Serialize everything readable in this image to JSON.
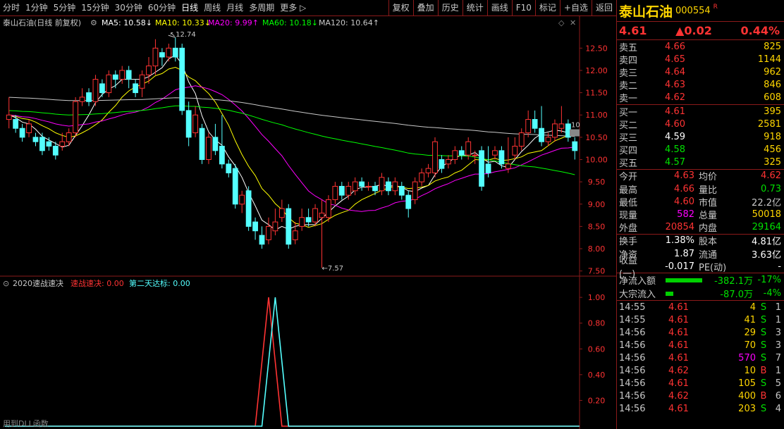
{
  "toolbar": {
    "left": [
      "分时",
      "1分钟",
      "5分钟",
      "15分钟",
      "30分钟",
      "60分钟",
      "日线",
      "周线",
      "月线",
      "多周期",
      "更多 ▷"
    ],
    "active": "日线",
    "right": [
      "复权",
      "叠加",
      "历史",
      "统计",
      "画线",
      "F10",
      "标记",
      "+自选",
      "返回"
    ]
  },
  "main": {
    "title": "泰山石油(日线 前复权)",
    "ma": [
      {
        "label": "MA5: 10.58↓",
        "color": "#ffffff"
      },
      {
        "label": "MA10: 10.33↓",
        "color": "#ffff00"
      },
      {
        "label": "MA20: 9.99↑",
        "color": "#ff00ff"
      },
      {
        "label": "MA60: 10.18↓",
        "color": "#00ff00"
      },
      {
        "label": "MA120: 10.64↑",
        "color": "#c8c8c8"
      }
    ],
    "hi_label": "12.74",
    "lo_label": "7.57",
    "last_marker": "10"
  },
  "indicator": {
    "name": "2020速战速决",
    "s1": "速战速决: 0.00",
    "s2": "第二天达标: 0.00",
    "footer": "用到DLL函数"
  },
  "colors": {
    "up": "#ff3333",
    "down": "#54ffff",
    "border": "#8b1a1a"
  },
  "chart_data": [
    {
      "type": "candlestick",
      "y_ticks": [
        "12.50",
        "12.00",
        "11.50",
        "11.00",
        "10.50",
        "10.00",
        "9.50",
        "9.00",
        "8.50",
        "8.00",
        "7.50"
      ],
      "ylim": [
        7.4,
        12.9
      ],
      "candles": [
        [
          10.9,
          11.0,
          10.7,
          11.4
        ],
        [
          10.9,
          10.7,
          10.6,
          11.0
        ],
        [
          10.7,
          10.5,
          10.4,
          10.8
        ],
        [
          10.6,
          10.8,
          10.5,
          10.9
        ],
        [
          10.5,
          10.4,
          10.3,
          10.6
        ],
        [
          10.5,
          10.2,
          10.1,
          10.6
        ],
        [
          10.4,
          10.3,
          10.2,
          10.5
        ],
        [
          10.3,
          10.1,
          10.0,
          10.4
        ],
        [
          10.3,
          10.4,
          10.2,
          10.6
        ],
        [
          10.4,
          10.6,
          10.3,
          10.7
        ],
        [
          10.6,
          11.3,
          10.5,
          11.4
        ],
        [
          11.3,
          11.4,
          11.2,
          11.6
        ],
        [
          11.5,
          11.3,
          11.2,
          11.6
        ],
        [
          11.3,
          11.8,
          11.2,
          11.9
        ],
        [
          11.7,
          11.5,
          11.4,
          11.8
        ],
        [
          11.5,
          11.9,
          11.4,
          12.0
        ],
        [
          11.9,
          11.8,
          11.6,
          12.0
        ],
        [
          11.8,
          12.0,
          11.7,
          12.1
        ],
        [
          12.0,
          11.8,
          11.6,
          12.1
        ],
        [
          11.7,
          11.5,
          11.4,
          11.8
        ],
        [
          11.6,
          11.9,
          11.4,
          12.0
        ],
        [
          11.9,
          12.1,
          11.7,
          12.3
        ],
        [
          12.1,
          12.5,
          11.9,
          12.7
        ],
        [
          12.4,
          12.3,
          12.1,
          12.5
        ],
        [
          12.3,
          12.5,
          12.2,
          12.6
        ],
        [
          12.5,
          12.3,
          12.2,
          12.74
        ],
        [
          12.5,
          11.1,
          11.0,
          12.6
        ],
        [
          11.1,
          10.5,
          10.3,
          11.3
        ],
        [
          10.6,
          11.0,
          10.5,
          11.2
        ],
        [
          10.7,
          10.0,
          9.9,
          10.8
        ],
        [
          10.0,
          10.5,
          9.9,
          10.6
        ],
        [
          10.5,
          10.2,
          10.1,
          10.8
        ],
        [
          10.3,
          9.9,
          9.8,
          11.0
        ],
        [
          9.9,
          9.7,
          9.6,
          10.0
        ],
        [
          9.8,
          9.0,
          8.9,
          9.9
        ],
        [
          9.0,
          9.2,
          8.8,
          9.3
        ],
        [
          9.3,
          8.5,
          8.4,
          9.4
        ],
        [
          8.6,
          8.4,
          8.2,
          8.7
        ],
        [
          8.3,
          8.1,
          8.0,
          8.5
        ],
        [
          8.2,
          8.5,
          8.1,
          8.7
        ],
        [
          8.4,
          8.6,
          8.3,
          8.9
        ],
        [
          8.7,
          8.9,
          8.6,
          9.1
        ],
        [
          8.9,
          8.1,
          8.0,
          9.0
        ],
        [
          8.2,
          8.4,
          8.1,
          8.6
        ],
        [
          8.5,
          8.7,
          8.4,
          8.9
        ],
        [
          8.7,
          8.6,
          8.5,
          8.9
        ],
        [
          8.6,
          8.9,
          8.5,
          9.0
        ],
        [
          8.7,
          8.8,
          7.57,
          9.1
        ],
        [
          8.7,
          9.1,
          8.6,
          9.2
        ],
        [
          9.1,
          9.4,
          9.0,
          9.5
        ],
        [
          9.4,
          9.2,
          9.1,
          9.5
        ],
        [
          9.2,
          9.4,
          9.1,
          9.5
        ],
        [
          9.3,
          9.5,
          9.2,
          9.6
        ],
        [
          9.5,
          9.4,
          9.3,
          9.6
        ],
        [
          9.4,
          9.4,
          9.3,
          9.5
        ],
        [
          9.4,
          9.3,
          9.2,
          9.5
        ],
        [
          9.3,
          9.6,
          9.2,
          9.7
        ],
        [
          9.5,
          9.3,
          9.2,
          9.6
        ],
        [
          9.3,
          9.5,
          9.2,
          9.6
        ],
        [
          9.4,
          9.2,
          9.1,
          9.5
        ],
        [
          9.2,
          8.9,
          8.7,
          9.3
        ],
        [
          9.1,
          9.5,
          9.0,
          9.6
        ],
        [
          9.5,
          9.7,
          9.4,
          9.8
        ],
        [
          9.7,
          9.8,
          9.6,
          9.9
        ],
        [
          9.7,
          10.4,
          9.6,
          10.5
        ],
        [
          10.0,
          9.8,
          9.7,
          10.1
        ],
        [
          9.9,
          10.0,
          9.8,
          10.1
        ],
        [
          10.0,
          10.2,
          9.9,
          10.3
        ],
        [
          10.2,
          10.1,
          10.0,
          10.3
        ],
        [
          10.1,
          10.4,
          10.0,
          10.5
        ],
        [
          10.1,
          10.1,
          9.9,
          10.2
        ],
        [
          10.2,
          9.4,
          9.3,
          10.3
        ],
        [
          9.9,
          9.7,
          9.6,
          10.3
        ],
        [
          10.1,
          10.2,
          10.0,
          10.3
        ],
        [
          10.2,
          9.9,
          9.8,
          10.3
        ],
        [
          9.8,
          9.9,
          9.7,
          10.5
        ],
        [
          10.1,
          10.3,
          10.0,
          10.5
        ],
        [
          10.3,
          10.6,
          10.2,
          10.7
        ],
        [
          10.6,
          10.9,
          10.5,
          11.1
        ],
        [
          10.9,
          10.7,
          10.6,
          11.1
        ],
        [
          10.7,
          10.4,
          10.3,
          11.2
        ],
        [
          10.4,
          10.5,
          10.3,
          10.6
        ],
        [
          10.5,
          10.8,
          10.4,
          10.9
        ],
        [
          10.7,
          10.8,
          10.6,
          11.2
        ],
        [
          10.8,
          10.5,
          10.4,
          10.9
        ],
        [
          10.4,
          10.2,
          10.0,
          10.5
        ]
      ],
      "ma_series": [
        "MA5",
        "MA10",
        "MA20",
        "MA60",
        "MA120"
      ]
    },
    {
      "type": "line",
      "y_ticks": [
        "1.00",
        "0.80",
        "0.60",
        "0.40",
        "0.20"
      ],
      "ylim": [
        0,
        1.05
      ],
      "series": [
        {
          "name": "速战速决",
          "color": "#ff3333",
          "spikes": [
            {
              "from": 37,
              "peak": 39,
              "to": 41,
              "value": 1.0
            }
          ]
        },
        {
          "name": "第二天达标",
          "color": "#54ffff",
          "spikes": [
            {
              "from": 38,
              "peak": 40,
              "to": 42,
              "value": 1.0
            }
          ]
        }
      ]
    }
  ],
  "side": {
    "name": "泰山石油",
    "code": "000554",
    "flag": "R",
    "price": "4.61",
    "change": "▲0.02",
    "pct": "0.44%",
    "asks": [
      {
        "lbl": "卖五",
        "p": "4.66",
        "v": "825"
      },
      {
        "lbl": "卖四",
        "p": "4.65",
        "v": "1144"
      },
      {
        "lbl": "卖三",
        "p": "4.64",
        "v": "962"
      },
      {
        "lbl": "卖二",
        "p": "4.63",
        "v": "846"
      },
      {
        "lbl": "卖一",
        "p": "4.62",
        "v": "608"
      }
    ],
    "bids": [
      {
        "lbl": "买一",
        "p": "4.61",
        "v": "395",
        "pc": "#ff3333"
      },
      {
        "lbl": "买二",
        "p": "4.60",
        "v": "2581",
        "pc": "#ff3333"
      },
      {
        "lbl": "买三",
        "p": "4.59",
        "v": "918",
        "pc": "#ffffff"
      },
      {
        "lbl": "买四",
        "p": "4.58",
        "v": "456",
        "pc": "#00e000"
      },
      {
        "lbl": "买五",
        "p": "4.57",
        "v": "325",
        "pc": "#00e000"
      }
    ],
    "stats": [
      {
        "a": "今开",
        "b": "4.63",
        "bc": "#ff3333",
        "c": "均价",
        "d": "4.62",
        "dc": "#ff3333"
      },
      {
        "a": "最高",
        "b": "4.66",
        "bc": "#ff3333",
        "c": "量比",
        "d": "0.73",
        "dc": "#00e000"
      },
      {
        "a": "最低",
        "b": "4.60",
        "bc": "#ff3333",
        "c": "市值",
        "d": "22.2亿",
        "dc": "#c8c8c8"
      },
      {
        "a": "现量",
        "b": "582",
        "bc": "#ff00ff",
        "c": "总量",
        "d": "50018",
        "dc": "#ffd600"
      },
      {
        "a": "外盘",
        "b": "20854",
        "bc": "#ff3333",
        "c": "内盘",
        "d": "29164",
        "dc": "#00e000"
      }
    ],
    "stats2": [
      {
        "a": "换手",
        "b": "1.38%",
        "c": "股本",
        "d": "4.81亿"
      },
      {
        "a": "净资",
        "b": "1.87",
        "c": "流通",
        "d": "3.63亿"
      },
      {
        "a": "收益(一)",
        "b": "-0.017",
        "c": "PE(动)",
        "d": "-"
      }
    ],
    "flows": [
      {
        "lbl": "净流入额",
        "bar": 0.95,
        "v": "-382.1万",
        "p": "-17%"
      },
      {
        "lbl": "大宗流入",
        "bar": 0.2,
        "v": "-87.0万",
        "p": "-4%"
      }
    ],
    "ticks": [
      {
        "t": "14:55",
        "p": "4.61",
        "v": "4",
        "d": "S",
        "dc": "#00e000",
        "vc": "#ffd600",
        "n": "1"
      },
      {
        "t": "14:55",
        "p": "4.61",
        "v": "41",
        "d": "S",
        "dc": "#00e000",
        "vc": "#ffd600",
        "n": "1"
      },
      {
        "t": "14:56",
        "p": "4.61",
        "v": "29",
        "d": "S",
        "dc": "#00e000",
        "vc": "#ffd600",
        "n": "3"
      },
      {
        "t": "14:56",
        "p": "4.61",
        "v": "70",
        "d": "S",
        "dc": "#00e000",
        "vc": "#ffd600",
        "n": "3"
      },
      {
        "t": "14:56",
        "p": "4.61",
        "v": "570",
        "d": "S",
        "dc": "#00e000",
        "vc": "#ff00ff",
        "n": "7"
      },
      {
        "t": "14:56",
        "p": "4.62",
        "v": "10",
        "d": "B",
        "dc": "#ff3333",
        "vc": "#ffd600",
        "n": "1"
      },
      {
        "t": "14:56",
        "p": "4.61",
        "v": "105",
        "d": "S",
        "dc": "#00e000",
        "vc": "#ffd600",
        "n": "5"
      },
      {
        "t": "14:56",
        "p": "4.62",
        "v": "400",
        "d": "B",
        "dc": "#ff3333",
        "vc": "#ffd600",
        "n": "6"
      },
      {
        "t": "14:56",
        "p": "4.61",
        "v": "203",
        "d": "S",
        "dc": "#00e000",
        "vc": "#ffd600",
        "n": "4"
      }
    ]
  }
}
